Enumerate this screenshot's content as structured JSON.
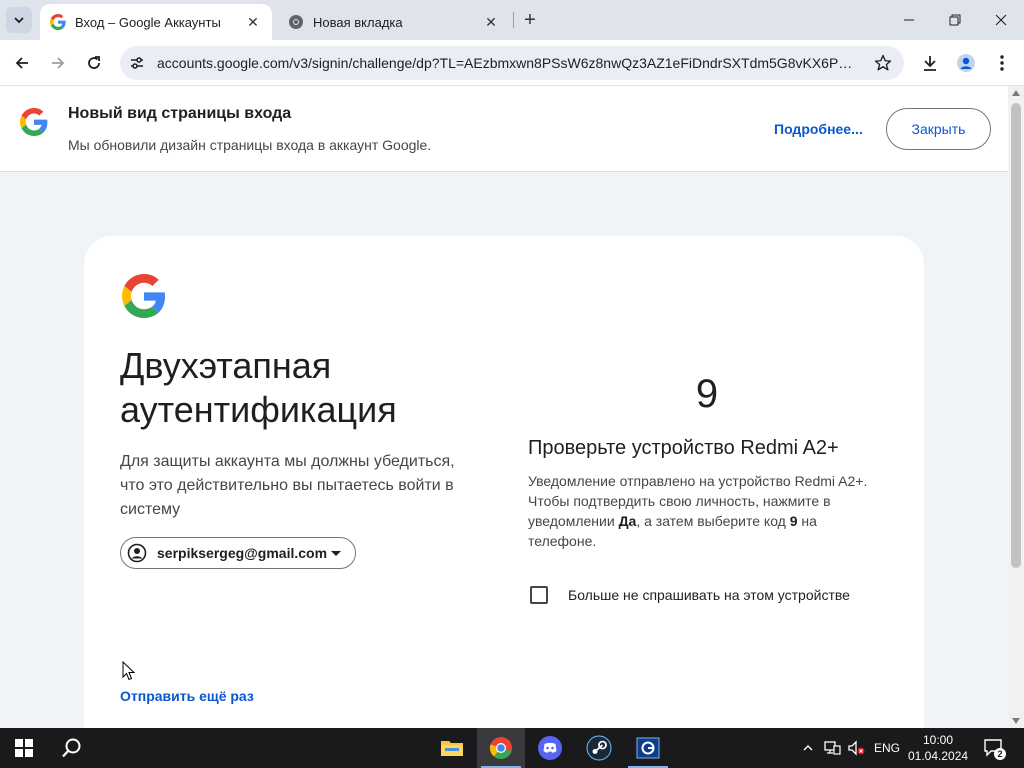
{
  "browser": {
    "tabs": [
      {
        "title": "Вход – Google Аккаунты",
        "active": true
      },
      {
        "title": "Новая вкладка",
        "active": false
      }
    ],
    "url": "accounts.google.com/v3/signin/challenge/dp?TL=AEzbmxwn8PSsW6z8nwQz3AZ1eFiDndrSXTdm5G8vKX6PowH..."
  },
  "banner": {
    "title": "Новый вид страницы входа",
    "text": "Мы обновили дизайн страницы входа в аккаунт Google.",
    "more_link": "Подробнее...",
    "close_button": "Закрыть"
  },
  "signin": {
    "heading": "Двухэтапная аутентификация",
    "subtext": "Для защиты аккаунта мы должны убедиться, что это действительно вы пытаетесь войти в систему",
    "account_email": "serpiksergeg@gmail.com",
    "resend_link": "Отправить ещё раз",
    "code_number": "9",
    "device_title": "Проверьте устройство Redmi A2+",
    "device_text_1": "Уведомление отправлено на устройство Redmi A2+. Чтобы подтвердить свою личность, нажмите в уведомлении ",
    "device_text_bold_1": "Да",
    "device_text_2": ", а затем выберите код ",
    "device_text_bold_2": "9",
    "device_text_3": " на телефоне.",
    "checkbox_label": "Больше не спрашивать на этом устройстве",
    "checkbox_checked": false
  },
  "taskbar": {
    "language": "ENG",
    "time": "10:00",
    "date": "01.04.2024",
    "notification_count": "2"
  },
  "colors": {
    "accent_blue": "#0b57d0",
    "page_background": "#f0f4f9",
    "google_blue": "#4285F4",
    "google_red": "#EA4335",
    "google_yellow": "#FBBC05",
    "google_green": "#34A853"
  }
}
